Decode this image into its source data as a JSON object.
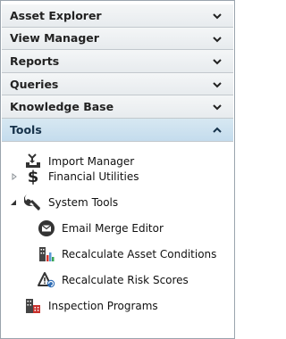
{
  "accordion": {
    "sections": [
      {
        "label": "Asset Explorer",
        "state": "collapsed"
      },
      {
        "label": "View Manager",
        "state": "collapsed"
      },
      {
        "label": "Reports",
        "state": "collapsed"
      },
      {
        "label": "Queries",
        "state": "collapsed"
      },
      {
        "label": "Knowledge Base",
        "state": "collapsed"
      },
      {
        "label": "Tools",
        "state": "expanded"
      }
    ]
  },
  "tools_tree": {
    "items": [
      {
        "label": "Import Manager",
        "icon": "import-tray-icon"
      },
      {
        "label": "Financial Utilities",
        "icon": "dollar-icon",
        "toggle": "collapsed"
      },
      {
        "label": "System Tools",
        "icon": "wrench-icon",
        "toggle": "expanded"
      },
      {
        "label": "Email Merge Editor",
        "icon": "email-icon"
      },
      {
        "label": "Recalculate Asset Conditions",
        "icon": "building-chart-icon"
      },
      {
        "label": "Recalculate Risk Scores",
        "icon": "risk-triangle-icon"
      },
      {
        "label": "Inspection Programs",
        "icon": "inspection-building-icon"
      }
    ]
  },
  "colors": {
    "active_header": "#c4dced",
    "header": "#e7ebee",
    "border": "#9aa4ad"
  }
}
